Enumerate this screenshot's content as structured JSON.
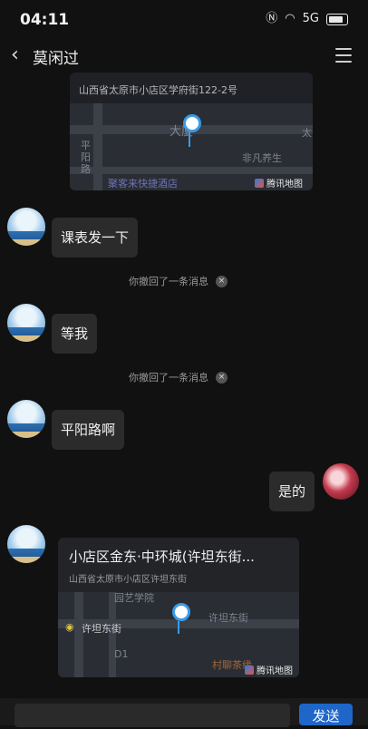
{
  "status": {
    "time": "04:11",
    "icons": [
      "nfc-icon",
      "wifi-icon",
      "signal-icon",
      "battery-icon"
    ],
    "signal_text": "5G"
  },
  "header": {
    "title": "莫闲过"
  },
  "map_card_1": {
    "address": "山西省太原市小店区学府街122-2号",
    "labels": [
      "大厦",
      "平阳路",
      "聚客来快捷酒店",
      "非凡养生",
      "太"
    ],
    "map_logo": "腾讯地图"
  },
  "messages": [
    {
      "from": "other",
      "text": "课表发一下"
    },
    {
      "type": "recall",
      "text": "你撤回了一条消息"
    },
    {
      "from": "other",
      "text": "等我"
    },
    {
      "type": "recall",
      "text": "你撤回了一条消息"
    },
    {
      "from": "other",
      "text": "平阳路啊"
    },
    {
      "from": "me",
      "text": "是的"
    }
  ],
  "map_card_2": {
    "title": "小店区金东·中环城(许坦东街...",
    "address": "山西省太原市小店区许坦东街",
    "labels": [
      "园艺学院",
      "许坦东街",
      "许坦东街",
      "D1",
      "村聊茶缘"
    ],
    "map_logo": "腾讯地图"
  },
  "input": {
    "send_label": "发送",
    "value": ""
  },
  "colors": {
    "accent": "#1f66c9",
    "pin": "#3a9be8"
  }
}
